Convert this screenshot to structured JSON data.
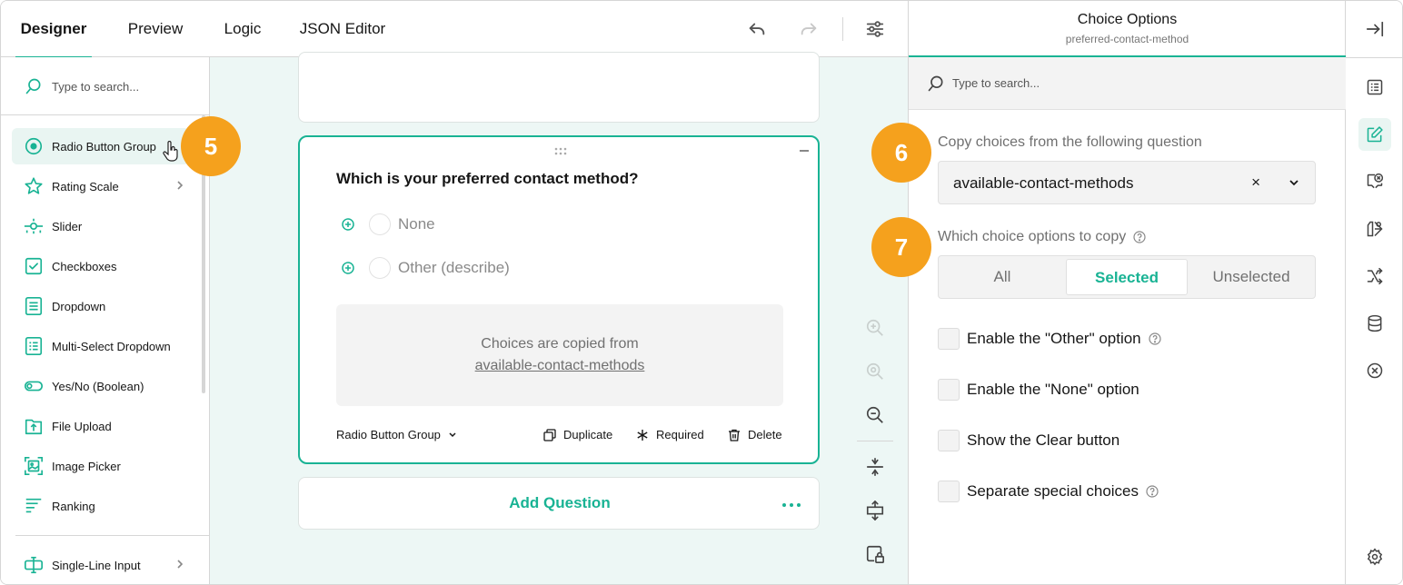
{
  "header": {
    "tabs": [
      {
        "label": "Designer",
        "active": true
      },
      {
        "label": "Preview"
      },
      {
        "label": "Logic"
      },
      {
        "label": "JSON Editor"
      }
    ]
  },
  "toolbox": {
    "search_placeholder": "Type to search...",
    "items": [
      {
        "label": "Radio Button Group",
        "icon": "radio-icon",
        "selected": true
      },
      {
        "label": "Rating Scale",
        "icon": "star-icon"
      },
      {
        "label": "Slider",
        "icon": "slider-icon"
      },
      {
        "label": "Checkboxes",
        "icon": "checkbox-icon"
      },
      {
        "label": "Dropdown",
        "icon": "dropdown-icon"
      },
      {
        "label": "Multi-Select Dropdown",
        "icon": "multiselect-icon"
      },
      {
        "label": "Yes/No (Boolean)",
        "icon": "toggle-icon"
      },
      {
        "label": "File Upload",
        "icon": "file-upload-icon"
      },
      {
        "label": "Image Picker",
        "icon": "image-picker-icon"
      },
      {
        "label": "Ranking",
        "icon": "ranking-icon"
      }
    ],
    "bottom_item": {
      "label": "Single-Line Input",
      "icon": "text-input-icon"
    }
  },
  "question": {
    "title": "Which is your preferred contact method?",
    "choices": [
      "None",
      "Other (describe)"
    ],
    "copied_text": "Choices are copied from",
    "copied_link": "available-contact-methods",
    "type_label": "Radio Button Group",
    "actions": {
      "duplicate": "Duplicate",
      "required": "Required",
      "delete": "Delete"
    }
  },
  "add_question": "Add Question",
  "badges": {
    "b5": "5",
    "b6": "6",
    "b7": "7"
  },
  "panel": {
    "title": "Choice Options",
    "subtitle": "preferred-contact-method",
    "search_placeholder": "Type to search...",
    "copy_from_label": "Copy choices from the following question",
    "copy_from_value": "available-contact-methods",
    "clear_glyph": "×",
    "which_label": "Which choice options to copy",
    "segments": [
      "All",
      "Selected",
      "Unselected"
    ],
    "selected_segment": "Selected",
    "checkboxes": [
      {
        "label": "Enable the \"Other\" option",
        "help": true,
        "checked": false
      },
      {
        "label": "Enable the \"None\" option",
        "help": false,
        "checked": false
      },
      {
        "label": "Show the Clear button",
        "help": false,
        "checked": false
      },
      {
        "label": "Separate special choices",
        "help": true,
        "checked": false
      }
    ]
  },
  "colors": {
    "accent": "#19b394",
    "badge": "#f5a11d",
    "canvas": "#edf7f5"
  }
}
